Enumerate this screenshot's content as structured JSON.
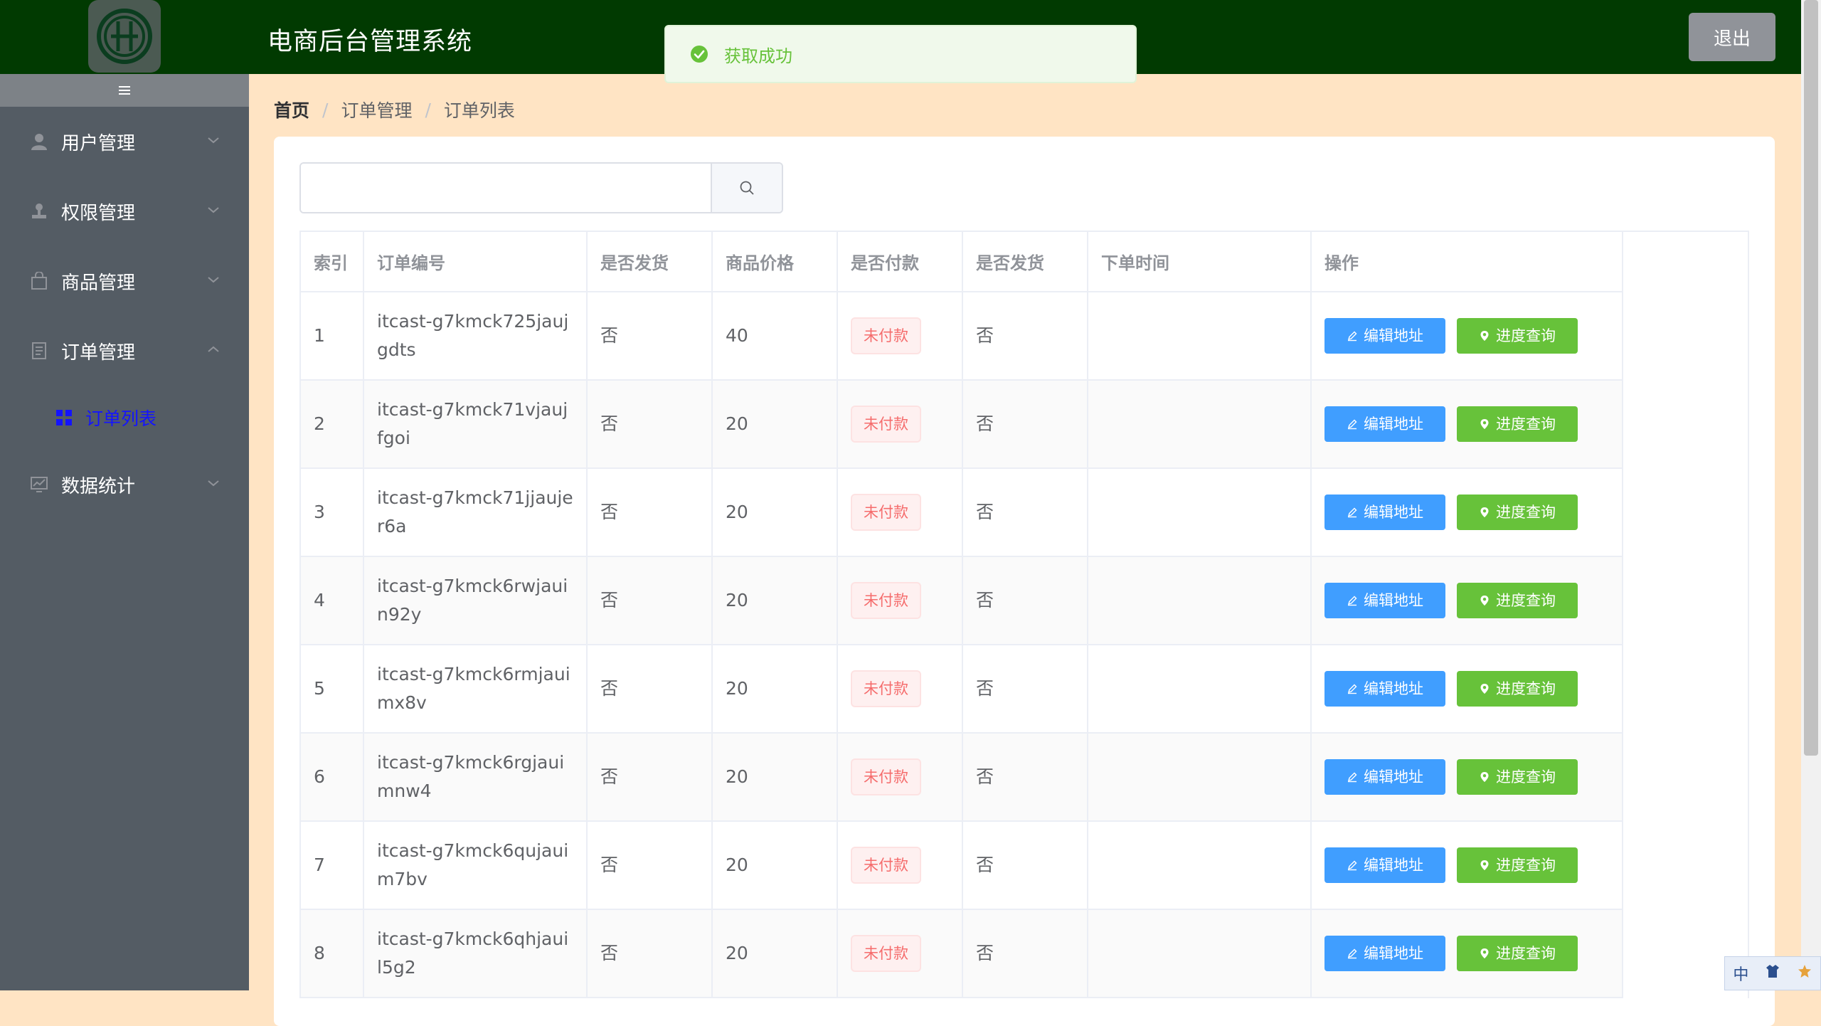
{
  "header": {
    "title": "电商后台管理系统",
    "logout_label": "退出"
  },
  "toast": {
    "message": "获取成功"
  },
  "sidebar": {
    "toggle_label": "|||",
    "menus": [
      {
        "label": "用户管理",
        "icon": "user-icon",
        "expanded": false
      },
      {
        "label": "权限管理",
        "icon": "stamp-icon",
        "expanded": false
      },
      {
        "label": "商品管理",
        "icon": "shopping-bag-icon",
        "expanded": false
      },
      {
        "label": "订单管理",
        "icon": "document-icon",
        "expanded": true
      },
      {
        "label": "数据统计",
        "icon": "data-line-icon",
        "expanded": false
      }
    ],
    "submenu": {
      "label": "订单列表",
      "icon": "grid-icon"
    }
  },
  "breadcrumb": {
    "home": "首页",
    "level1": "订单管理",
    "level2": "订单列表",
    "separator": "/"
  },
  "search": {
    "value": "",
    "placeholder": ""
  },
  "table": {
    "columns": [
      "索引",
      "订单编号",
      "是否发货",
      "商品价格",
      "是否付款",
      "是否发货",
      "下单时间",
      "操作"
    ],
    "edit_label": "编辑地址",
    "progress_label": "进度查询",
    "rows": [
      {
        "index": "1",
        "order_no": "itcast-g7kmck725jaujgdts",
        "shipped": "否",
        "price": "40",
        "paid": "未付款",
        "delivered": "否",
        "time": ""
      },
      {
        "index": "2",
        "order_no": "itcast-g7kmck71vjaujfgoi",
        "shipped": "否",
        "price": "20",
        "paid": "未付款",
        "delivered": "否",
        "time": ""
      },
      {
        "index": "3",
        "order_no": "itcast-g7kmck71jjaujer6a",
        "shipped": "否",
        "price": "20",
        "paid": "未付款",
        "delivered": "否",
        "time": ""
      },
      {
        "index": "4",
        "order_no": "itcast-g7kmck6rwjauin92y",
        "shipped": "否",
        "price": "20",
        "paid": "未付款",
        "delivered": "否",
        "time": ""
      },
      {
        "index": "5",
        "order_no": "itcast-g7kmck6rmjauimx8v",
        "shipped": "否",
        "price": "20",
        "paid": "未付款",
        "delivered": "否",
        "time": ""
      },
      {
        "index": "6",
        "order_no": "itcast-g7kmck6rgjauimnw4",
        "shipped": "否",
        "price": "20",
        "paid": "未付款",
        "delivered": "否",
        "time": ""
      },
      {
        "index": "7",
        "order_no": "itcast-g7kmck6qujauim7bv",
        "shipped": "否",
        "price": "20",
        "paid": "未付款",
        "delivered": "否",
        "time": ""
      },
      {
        "index": "8",
        "order_no": "itcast-g7kmck6qhjauil5g2",
        "shipped": "否",
        "price": "20",
        "paid": "未付款",
        "delivered": "否",
        "time": ""
      }
    ]
  },
  "ime": {
    "mode": "中"
  },
  "colors": {
    "header_bg": "#013a01",
    "sidebar_bg": "#545c64",
    "page_bg": "#ffe4c4",
    "primary": "#409eff",
    "success": "#67c23a",
    "danger": "#f56c6c",
    "submenu_active": "#1414ff"
  }
}
